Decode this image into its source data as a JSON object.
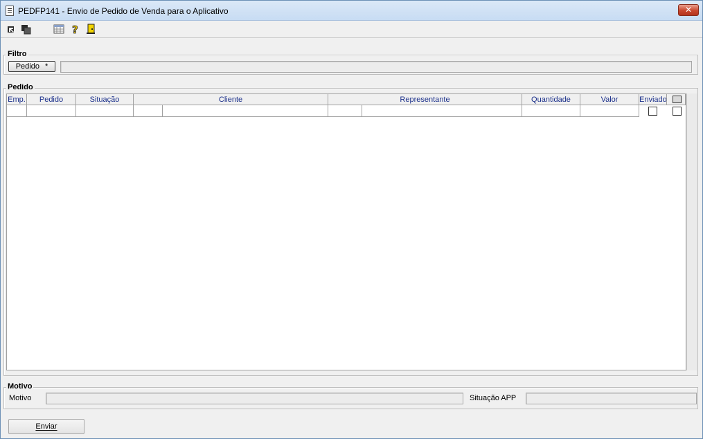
{
  "window": {
    "title": "PEDFP141 - Envio de Pedido de Venda para o Aplicativo",
    "close_label": "✕"
  },
  "toolbar": {
    "icons": [
      "first-record-icon",
      "previous-record-icon",
      "grid-icon",
      "help-icon",
      "exit-icon"
    ]
  },
  "filtro": {
    "title": "Filtro",
    "pedido_button": "Pedido",
    "pedido_marker": "*",
    "pedido_value": ""
  },
  "pedido": {
    "title": "Pedido",
    "columns": [
      "Emp.",
      "Pedido",
      "Situação",
      "Cliente",
      "Representante",
      "Quantidade",
      "Valor",
      "Enviado"
    ]
  },
  "motivo": {
    "title": "Motivo",
    "motivo_label": "Motivo",
    "motivo_value": "",
    "situacao_label": "Situação APP",
    "situacao_value": ""
  },
  "footer": {
    "enviar_label": "Enviar"
  }
}
